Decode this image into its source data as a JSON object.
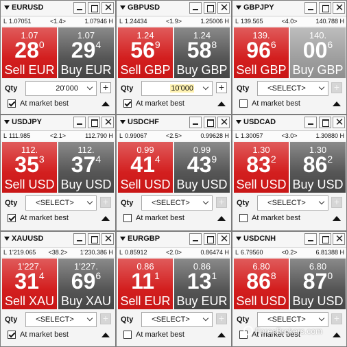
{
  "ui": {
    "high_label": "H",
    "low_label": "L",
    "qty_label": "Qty",
    "market_label": "At market best",
    "plus_sign": "+",
    "close_sign": "✕"
  },
  "colors": {
    "sell": "#d31f1f",
    "buy": "#565656",
    "buy_disabled": "#9f9f9f"
  },
  "watermark": "ForexBrokers.com",
  "tiles": [
    {
      "pair": "EURUSD",
      "low": "1.07051",
      "spread": "<1.4>",
      "high": "1.07946",
      "sell": {
        "big": "1.07",
        "pips": "28",
        "frac": "0",
        "label": "Sell EUR"
      },
      "buy": {
        "big": "1.07",
        "pips": "29",
        "frac": "4",
        "label": "Buy EUR"
      },
      "qty": "20'000",
      "qty_mode": "input",
      "checked": true
    },
    {
      "pair": "GBPUSD",
      "low": "1.24434",
      "spread": "<1.9>",
      "high": "1.25006",
      "sell": {
        "big": "1.24",
        "pips": "56",
        "frac": "9",
        "label": "Sell GBP"
      },
      "buy": {
        "big": "1.24",
        "pips": "58",
        "frac": "8",
        "label": "Buy GBP"
      },
      "qty": "10'000",
      "qty_mode": "input-active",
      "checked": true
    },
    {
      "pair": "GBPJPY",
      "low": "139.565",
      "spread": "<4.0>",
      "high": "140.788",
      "sell": {
        "big": "139.",
        "pips": "96",
        "frac": "6",
        "label": "Sell GBP"
      },
      "buy": {
        "big": "140.",
        "pips": "00",
        "frac": "6",
        "label": "Buy GBP",
        "disabled": true
      },
      "qty": "<SELECT>",
      "qty_mode": "select",
      "checked": false
    },
    {
      "pair": "USDJPY",
      "low": "111.985",
      "spread": "<2.1>",
      "high": "112.790",
      "sell": {
        "big": "112.",
        "pips": "35",
        "frac": "3",
        "label": "Sell USD"
      },
      "buy": {
        "big": "112.",
        "pips": "37",
        "frac": "4",
        "label": "Buy USD"
      },
      "qty": "<SELECT>",
      "qty_mode": "select",
      "checked": true
    },
    {
      "pair": "USDCHF",
      "low": "0.99067",
      "spread": "<2.5>",
      "high": "0.99628",
      "sell": {
        "big": "0.99",
        "pips": "41",
        "frac": "4",
        "label": "Sell USD"
      },
      "buy": {
        "big": "0.99",
        "pips": "43",
        "frac": "9",
        "label": "Buy USD"
      },
      "qty": "<SELECT>",
      "qty_mode": "select",
      "checked": false
    },
    {
      "pair": "USDCAD",
      "low": "1.30057",
      "spread": "<3.0>",
      "high": "1.30880",
      "sell": {
        "big": "1.30",
        "pips": "83",
        "frac": "2",
        "label": "Sell USD"
      },
      "buy": {
        "big": "1.30",
        "pips": "86",
        "frac": "2",
        "label": "Buy USD"
      },
      "qty": "<SELECT>",
      "qty_mode": "select",
      "checked": false
    },
    {
      "pair": "XAUUSD",
      "low": "1'219.065",
      "spread": "<38.2>",
      "high": "1'230.386",
      "sell": {
        "big": "1'227.",
        "pips": "31",
        "frac": "4",
        "label": "Sell XAU"
      },
      "buy": {
        "big": "1'227.",
        "pips": "69",
        "frac": "6",
        "label": "Buy XAU"
      },
      "qty": "<SELECT>",
      "qty_mode": "select",
      "checked": true
    },
    {
      "pair": "EURGBP",
      "low": "0.85912",
      "spread": "<2.0>",
      "high": "0.86474",
      "sell": {
        "big": "0.86",
        "pips": "11",
        "frac": "1",
        "label": "Sell EUR"
      },
      "buy": {
        "big": "0.86",
        "pips": "13",
        "frac": "1",
        "label": "Buy EUR"
      },
      "qty": "<SELECT>",
      "qty_mode": "select",
      "checked": false
    },
    {
      "pair": "USDCNH",
      "low": "6.79560",
      "spread": "<0.2>",
      "high": "6.81388",
      "sell": {
        "big": "6.80",
        "pips": "86",
        "frac": "8",
        "label": "Sell USD"
      },
      "buy": {
        "big": "6.80",
        "pips": "87",
        "frac": "0",
        "label": "Buy USD"
      },
      "qty": "<SELECT>",
      "qty_mode": "select",
      "checked": false
    }
  ]
}
